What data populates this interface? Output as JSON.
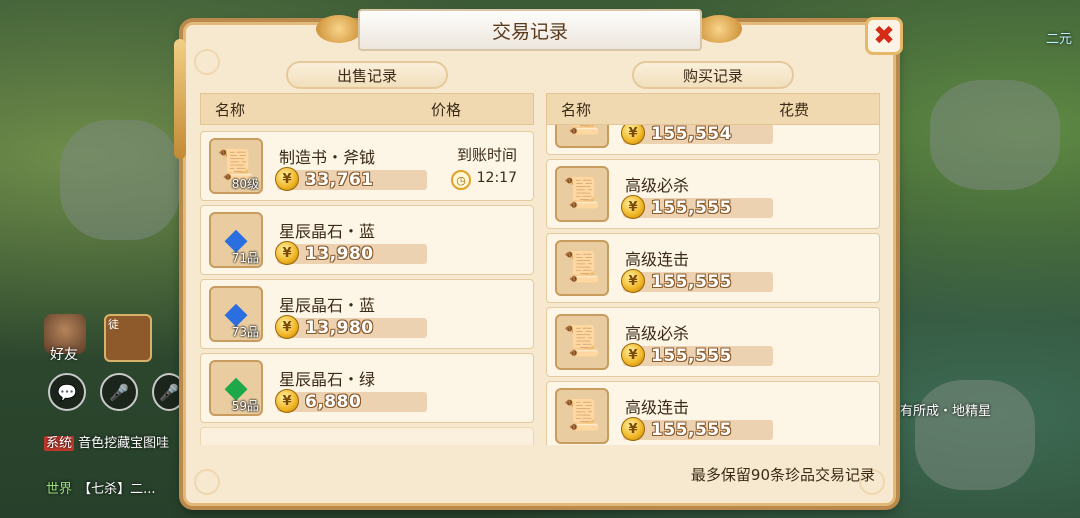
{
  "dialog": {
    "title": "交易记录",
    "close_symbol": "✖"
  },
  "sell": {
    "tab_label": "出售记录",
    "col_name": "名称",
    "col_price": "价格",
    "items": [
      {
        "name": "制造书・斧钺",
        "level": "80级",
        "price": "33,761",
        "arrive_label": "到账时间",
        "arrive_time": "12:17",
        "icon": "scroll-book-icon"
      },
      {
        "name": "星辰晶石・蓝",
        "level": "71品",
        "price": "13,980",
        "icon": "blue-crystal-icon"
      },
      {
        "name": "星辰晶石・蓝",
        "level": "73品",
        "price": "13,980",
        "icon": "blue-crystal-icon"
      },
      {
        "name": "星辰晶石・绿",
        "level": "59品",
        "price": "6,880",
        "icon": "green-crystal-icon"
      }
    ]
  },
  "buy": {
    "tab_label": "购买记录",
    "col_name": "名称",
    "col_cost": "花费",
    "items": [
      {
        "name": "",
        "price": "155,554",
        "icon": "scroll-icon"
      },
      {
        "name": "高级必杀",
        "price": "155,555",
        "icon": "scroll-icon"
      },
      {
        "name": "高级连击",
        "price": "155,555",
        "icon": "scroll-icon"
      },
      {
        "name": "高级必杀",
        "price": "155,555",
        "icon": "scroll-icon"
      },
      {
        "name": "高级连击",
        "price": "155,555",
        "icon": "scroll-icon"
      }
    ]
  },
  "footer_note": "最多保留90条珍品交易记录",
  "hud": {
    "friend_label": "好友",
    "pet_tag": "徒",
    "chat_lines": [
      {
        "channel": "系统",
        "text": "音色挖藏宝图哇"
      },
      {
        "channel": "世界",
        "text": "【七杀】二..."
      }
    ],
    "right_top": "二元",
    "right_mid": "有所成・地精星"
  },
  "colors": {
    "accent_border": "#e2b978",
    "coin": "#f0b422",
    "close": "#d62b16"
  }
}
